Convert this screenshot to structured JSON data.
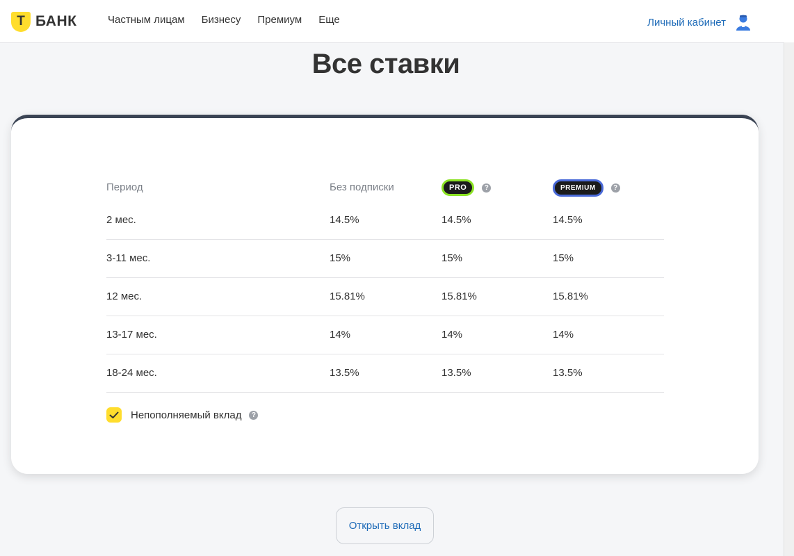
{
  "header": {
    "logo_letter": "Т",
    "logo_text": "БАНК",
    "nav": [
      "Частным лицам",
      "Бизнесу",
      "Премиум",
      "Еще"
    ],
    "account_label": "Личный кабинет"
  },
  "title": "Все ставки",
  "table": {
    "headers": {
      "period": "Период",
      "no_sub": "Без подписки",
      "pro": "PRO",
      "premium": "PREMIUM"
    },
    "rows": [
      {
        "period": "2 мес.",
        "no_sub": "14.5%",
        "pro": "14.5%",
        "premium": "14.5%"
      },
      {
        "period": "3-11 мес.",
        "no_sub": "15%",
        "pro": "15%",
        "premium": "15%"
      },
      {
        "period": "12 мес.",
        "no_sub": "15.81%",
        "pro": "15.81%",
        "premium": "15.81%"
      },
      {
        "period": "13-17 мес.",
        "no_sub": "14%",
        "pro": "14%",
        "premium": "14%"
      },
      {
        "period": "18-24 мес.",
        "no_sub": "13.5%",
        "pro": "13.5%",
        "premium": "13.5%"
      }
    ]
  },
  "checkbox": {
    "label": "Непополняемый вклад",
    "checked": true
  },
  "open_button": "Открыть вклад",
  "help_glyph": "?",
  "colors": {
    "brand_yellow": "#ffdd2d",
    "link_blue": "#1e6bb8",
    "pro_green": "#8be223",
    "premium_blue": "#4a6ad8"
  }
}
